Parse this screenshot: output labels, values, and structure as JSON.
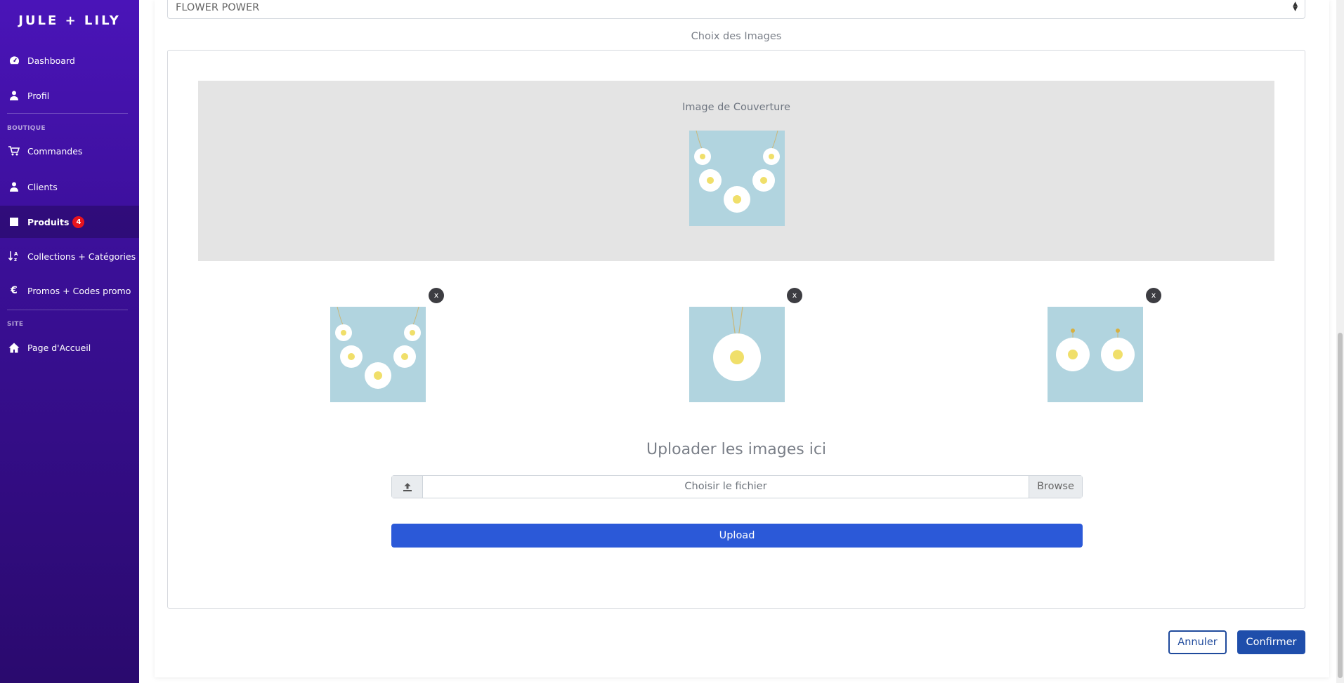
{
  "brand": "JULE + LILY",
  "sidebar": {
    "items": [
      {
        "label": "Dashboard",
        "icon": "dashboard-icon"
      },
      {
        "label": "Profil",
        "icon": "user-icon"
      },
      {
        "label": "Commandes",
        "icon": "cart-icon"
      },
      {
        "label": "Clients",
        "icon": "user-icon"
      },
      {
        "label": "Produits",
        "icon": "square-icon",
        "badge": "4"
      },
      {
        "label": "Collections + Catégories",
        "icon": "sort-az-icon"
      },
      {
        "label": "Promos + Codes promo",
        "icon": "euro-icon"
      },
      {
        "label": "Page d'Accueil",
        "icon": "home-icon"
      }
    ],
    "sections": {
      "boutique": "BOUTIQUE",
      "site": "SITE"
    }
  },
  "form": {
    "collection_value": "FLOWER POWER",
    "images_title": "Choix des Images",
    "cover_label": "Image de Couverture",
    "close_label": "x",
    "upload_title": "Uploader les images ici",
    "file_placeholder": "Choisir le fichier",
    "browse_label": "Browse",
    "upload_label": "Upload",
    "cancel_label": "Annuler",
    "confirm_label": "Confirmer"
  },
  "colors": {
    "sidebar_top": "#4a14b8",
    "sidebar_bottom": "#2a0a6e",
    "upload_button": "#2b59d8",
    "confirm_button": "#1f4eab",
    "badge": "#e8141e",
    "thumb_bg": "#b1d4df"
  }
}
